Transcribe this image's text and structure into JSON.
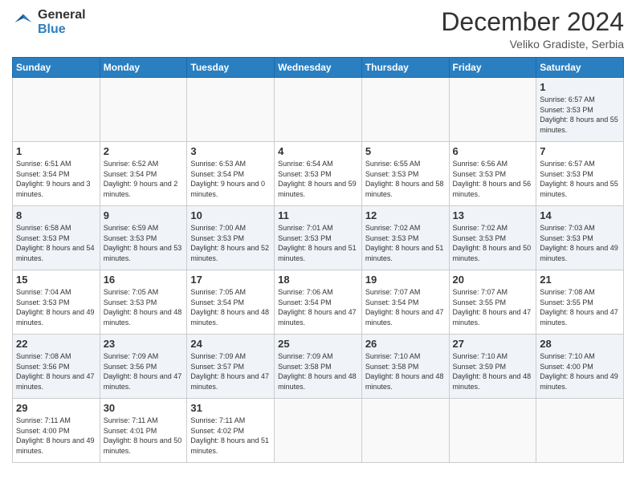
{
  "header": {
    "logo": {
      "general": "General",
      "blue": "Blue"
    },
    "title": "December 2024",
    "location": "Veliko Gradiste, Serbia"
  },
  "calendar": {
    "days_of_week": [
      "Sunday",
      "Monday",
      "Tuesday",
      "Wednesday",
      "Thursday",
      "Friday",
      "Saturday"
    ],
    "weeks": [
      [
        null,
        null,
        null,
        null,
        null,
        null,
        {
          "day": 1,
          "sunrise": "6:57 AM",
          "sunset": "3:53 PM",
          "daylight": "8 hours and 55 minutes."
        }
      ],
      [
        {
          "day": 1,
          "sunrise": "6:51 AM",
          "sunset": "3:54 PM",
          "daylight": "9 hours and 3 minutes."
        },
        {
          "day": 2,
          "sunrise": "6:52 AM",
          "sunset": "3:54 PM",
          "daylight": "9 hours and 2 minutes."
        },
        {
          "day": 3,
          "sunrise": "6:53 AM",
          "sunset": "3:54 PM",
          "daylight": "9 hours and 0 minutes."
        },
        {
          "day": 4,
          "sunrise": "6:54 AM",
          "sunset": "3:53 PM",
          "daylight": "8 hours and 59 minutes."
        },
        {
          "day": 5,
          "sunrise": "6:55 AM",
          "sunset": "3:53 PM",
          "daylight": "8 hours and 58 minutes."
        },
        {
          "day": 6,
          "sunrise": "6:56 AM",
          "sunset": "3:53 PM",
          "daylight": "8 hours and 56 minutes."
        },
        {
          "day": 7,
          "sunrise": "6:57 AM",
          "sunset": "3:53 PM",
          "daylight": "8 hours and 55 minutes."
        }
      ],
      [
        {
          "day": 8,
          "sunrise": "6:58 AM",
          "sunset": "3:53 PM",
          "daylight": "8 hours and 54 minutes."
        },
        {
          "day": 9,
          "sunrise": "6:59 AM",
          "sunset": "3:53 PM",
          "daylight": "8 hours and 53 minutes."
        },
        {
          "day": 10,
          "sunrise": "7:00 AM",
          "sunset": "3:53 PM",
          "daylight": "8 hours and 52 minutes."
        },
        {
          "day": 11,
          "sunrise": "7:01 AM",
          "sunset": "3:53 PM",
          "daylight": "8 hours and 51 minutes."
        },
        {
          "day": 12,
          "sunrise": "7:02 AM",
          "sunset": "3:53 PM",
          "daylight": "8 hours and 51 minutes."
        },
        {
          "day": 13,
          "sunrise": "7:02 AM",
          "sunset": "3:53 PM",
          "daylight": "8 hours and 50 minutes."
        },
        {
          "day": 14,
          "sunrise": "7:03 AM",
          "sunset": "3:53 PM",
          "daylight": "8 hours and 49 minutes."
        }
      ],
      [
        {
          "day": 15,
          "sunrise": "7:04 AM",
          "sunset": "3:53 PM",
          "daylight": "8 hours and 49 minutes."
        },
        {
          "day": 16,
          "sunrise": "7:05 AM",
          "sunset": "3:53 PM",
          "daylight": "8 hours and 48 minutes."
        },
        {
          "day": 17,
          "sunrise": "7:05 AM",
          "sunset": "3:54 PM",
          "daylight": "8 hours and 48 minutes."
        },
        {
          "day": 18,
          "sunrise": "7:06 AM",
          "sunset": "3:54 PM",
          "daylight": "8 hours and 47 minutes."
        },
        {
          "day": 19,
          "sunrise": "7:07 AM",
          "sunset": "3:54 PM",
          "daylight": "8 hours and 47 minutes."
        },
        {
          "day": 20,
          "sunrise": "7:07 AM",
          "sunset": "3:55 PM",
          "daylight": "8 hours and 47 minutes."
        },
        {
          "day": 21,
          "sunrise": "7:08 AM",
          "sunset": "3:55 PM",
          "daylight": "8 hours and 47 minutes."
        }
      ],
      [
        {
          "day": 22,
          "sunrise": "7:08 AM",
          "sunset": "3:56 PM",
          "daylight": "8 hours and 47 minutes."
        },
        {
          "day": 23,
          "sunrise": "7:09 AM",
          "sunset": "3:56 PM",
          "daylight": "8 hours and 47 minutes."
        },
        {
          "day": 24,
          "sunrise": "7:09 AM",
          "sunset": "3:57 PM",
          "daylight": "8 hours and 47 minutes."
        },
        {
          "day": 25,
          "sunrise": "7:09 AM",
          "sunset": "3:58 PM",
          "daylight": "8 hours and 48 minutes."
        },
        {
          "day": 26,
          "sunrise": "7:10 AM",
          "sunset": "3:58 PM",
          "daylight": "8 hours and 48 minutes."
        },
        {
          "day": 27,
          "sunrise": "7:10 AM",
          "sunset": "3:59 PM",
          "daylight": "8 hours and 48 minutes."
        },
        {
          "day": 28,
          "sunrise": "7:10 AM",
          "sunset": "4:00 PM",
          "daylight": "8 hours and 49 minutes."
        }
      ],
      [
        {
          "day": 29,
          "sunrise": "7:11 AM",
          "sunset": "4:00 PM",
          "daylight": "8 hours and 49 minutes."
        },
        {
          "day": 30,
          "sunrise": "7:11 AM",
          "sunset": "4:01 PM",
          "daylight": "8 hours and 50 minutes."
        },
        {
          "day": 31,
          "sunrise": "7:11 AM",
          "sunset": "4:02 PM",
          "daylight": "8 hours and 51 minutes."
        },
        null,
        null,
        null,
        null
      ]
    ]
  }
}
